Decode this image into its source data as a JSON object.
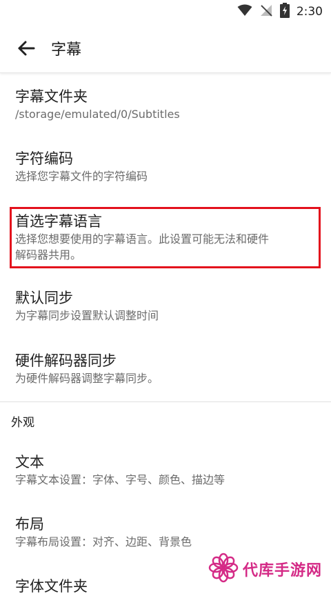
{
  "status": {
    "time": "2:30"
  },
  "app_bar": {
    "title": "字幕"
  },
  "settings": [
    {
      "title": "字幕文件夹",
      "subtitle": "/storage/emulated/0/Subtitles"
    },
    {
      "title": "字符编码",
      "subtitle": "选择您字幕文件的字符编码"
    },
    {
      "title": "首选字幕语言",
      "subtitle_line1": "选择您想要使用的字幕语言。此设置可能无法和硬件",
      "subtitle_line2": "解码器共用。"
    },
    {
      "title": "默认同步",
      "subtitle": "为字幕同步设置默认调整时间"
    },
    {
      "title": "硬件解码器同步",
      "subtitle": "为硬件解码器调整字幕同步。"
    }
  ],
  "appearance": {
    "header": "外观",
    "items": [
      {
        "title": "文本",
        "subtitle": "字幕文本设置：字体、字号、颜色、描边等"
      },
      {
        "title": "布局",
        "subtitle": "字幕布局设置：对齐、边距、背景色"
      },
      {
        "title": "字体文件夹"
      }
    ]
  },
  "watermark": {
    "text": "代库手游网"
  },
  "colors": {
    "highlight": "#e3101c",
    "watermark": "#d42a86"
  }
}
